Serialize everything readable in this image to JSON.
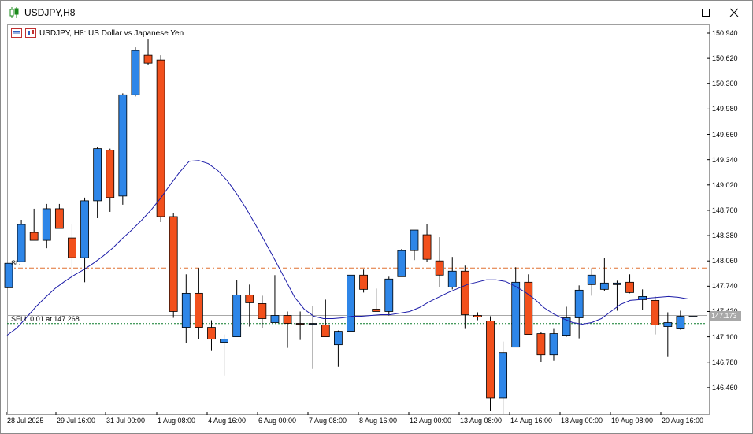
{
  "window": {
    "title": "USDJPY,H8"
  },
  "chart_header": {
    "text": "USDJPY, H8:  US Dollar vs Japanese Yen"
  },
  "trade_line": {
    "label": "SELL 0.01 at 147.268"
  },
  "current_price_tag": "147.173",
  "left_marker": "SU",
  "colors": {
    "bull": "#2e86e8",
    "bear": "#f2501c",
    "ma": "#1c1ca8",
    "sell_line": "#0a7a2a",
    "level_line": "#e07030",
    "price_line": "#a8a8a8"
  },
  "chart_data": {
    "type": "candlestick",
    "symbol": "USDJPY",
    "timeframe": "H8",
    "ylim": [
      146.16,
      150.96
    ],
    "y_ticks": [
      "150.940",
      "150.620",
      "150.300",
      "149.980",
      "149.660",
      "149.340",
      "149.020",
      "148.700",
      "148.380",
      "148.060",
      "147.740",
      "147.420",
      "147.100",
      "146.780",
      "146.460"
    ],
    "x_ticks": [
      "28 Jul 2025",
      "29 Jul 16:00",
      "31 Jul 00:00",
      "1 Aug 08:00",
      "4 Aug 16:00",
      "6 Aug 00:00",
      "7 Aug 08:00",
      "8 Aug 16:00",
      "12 Aug 00:00",
      "13 Aug 08:00",
      "14 Aug 16:00",
      "18 Aug 00:00",
      "19 Aug 08:00",
      "20 Aug 16:00"
    ],
    "sell_price": 147.268,
    "horizontal_level": 147.97,
    "current_price": 147.37,
    "candles": [
      {
        "o": 147.72,
        "h": 148.03,
        "l": 147.72,
        "c": 148.03
      },
      {
        "o": 148.05,
        "h": 148.58,
        "l": 148.05,
        "c": 148.52
      },
      {
        "o": 148.42,
        "h": 148.72,
        "l": 148.32,
        "c": 148.32
      },
      {
        "o": 148.32,
        "h": 148.78,
        "l": 148.22,
        "c": 148.72
      },
      {
        "o": 148.72,
        "h": 148.78,
        "l": 148.47,
        "c": 148.47
      },
      {
        "o": 148.35,
        "h": 148.52,
        "l": 147.82,
        "c": 148.1
      },
      {
        "o": 148.1,
        "h": 148.86,
        "l": 147.79,
        "c": 148.82
      },
      {
        "o": 148.82,
        "h": 149.5,
        "l": 148.6,
        "c": 149.48
      },
      {
        "o": 149.46,
        "h": 149.48,
        "l": 148.68,
        "c": 148.86
      },
      {
        "o": 148.88,
        "h": 150.18,
        "l": 148.77,
        "c": 150.16
      },
      {
        "o": 150.16,
        "h": 150.76,
        "l": 150.14,
        "c": 150.72
      },
      {
        "o": 150.66,
        "h": 150.86,
        "l": 150.54,
        "c": 150.56
      },
      {
        "o": 150.6,
        "h": 150.66,
        "l": 148.55,
        "c": 148.62
      },
      {
        "o": 148.62,
        "h": 148.67,
        "l": 147.34,
        "c": 147.42
      },
      {
        "o": 147.22,
        "h": 147.89,
        "l": 147.02,
        "c": 147.65
      },
      {
        "o": 147.65,
        "h": 147.97,
        "l": 147.07,
        "c": 147.22
      },
      {
        "o": 147.22,
        "h": 147.31,
        "l": 146.93,
        "c": 147.07
      },
      {
        "o": 147.03,
        "h": 147.13,
        "l": 146.61,
        "c": 147.07
      },
      {
        "o": 147.1,
        "h": 147.82,
        "l": 147.1,
        "c": 147.63
      },
      {
        "o": 147.63,
        "h": 147.76,
        "l": 147.23,
        "c": 147.53
      },
      {
        "o": 147.52,
        "h": 147.62,
        "l": 147.21,
        "c": 147.33
      },
      {
        "o": 147.28,
        "h": 147.88,
        "l": 147.28,
        "c": 147.37
      },
      {
        "o": 147.37,
        "h": 147.42,
        "l": 146.96,
        "c": 147.27
      },
      {
        "o": 147.27,
        "h": 147.42,
        "l": 147.06,
        "c": 147.26
      },
      {
        "o": 147.26,
        "h": 147.49,
        "l": 146.7,
        "c": 147.27
      },
      {
        "o": 147.25,
        "h": 147.57,
        "l": 147.1,
        "c": 147.1
      },
      {
        "o": 147.0,
        "h": 147.18,
        "l": 146.72,
        "c": 147.17
      },
      {
        "o": 147.17,
        "h": 147.91,
        "l": 147.15,
        "c": 147.88
      },
      {
        "o": 147.88,
        "h": 147.95,
        "l": 147.66,
        "c": 147.7
      },
      {
        "o": 147.45,
        "h": 147.71,
        "l": 147.43,
        "c": 147.42
      },
      {
        "o": 147.42,
        "h": 147.86,
        "l": 147.37,
        "c": 147.83
      },
      {
        "o": 147.86,
        "h": 148.21,
        "l": 147.86,
        "c": 148.19
      },
      {
        "o": 148.19,
        "h": 148.45,
        "l": 148.07,
        "c": 148.45
      },
      {
        "o": 148.39,
        "h": 148.53,
        "l": 148.05,
        "c": 148.08
      },
      {
        "o": 148.06,
        "h": 148.36,
        "l": 147.73,
        "c": 147.88
      },
      {
        "o": 147.73,
        "h": 148.11,
        "l": 147.7,
        "c": 147.93
      },
      {
        "o": 147.93,
        "h": 148.0,
        "l": 147.2,
        "c": 147.38
      },
      {
        "o": 147.37,
        "h": 147.41,
        "l": 147.31,
        "c": 147.35
      },
      {
        "o": 147.3,
        "h": 147.36,
        "l": 146.16,
        "c": 146.33
      },
      {
        "o": 146.33,
        "h": 147.04,
        "l": 146.13,
        "c": 146.9
      },
      {
        "o": 146.97,
        "h": 147.98,
        "l": 146.97,
        "c": 147.79
      },
      {
        "o": 147.79,
        "h": 147.89,
        "l": 147.13,
        "c": 147.13
      },
      {
        "o": 147.14,
        "h": 147.16,
        "l": 146.78,
        "c": 146.87
      },
      {
        "o": 146.87,
        "h": 147.2,
        "l": 146.8,
        "c": 147.14
      },
      {
        "o": 147.12,
        "h": 147.48,
        "l": 147.1,
        "c": 147.34
      },
      {
        "o": 147.34,
        "h": 147.75,
        "l": 147.08,
        "c": 147.69
      },
      {
        "o": 147.76,
        "h": 147.97,
        "l": 147.62,
        "c": 147.88
      },
      {
        "o": 147.7,
        "h": 148.1,
        "l": 147.68,
        "c": 147.78
      },
      {
        "o": 147.76,
        "h": 147.81,
        "l": 147.43,
        "c": 147.78
      },
      {
        "o": 147.79,
        "h": 147.89,
        "l": 147.65,
        "c": 147.66
      },
      {
        "o": 147.57,
        "h": 147.7,
        "l": 147.44,
        "c": 147.61
      },
      {
        "o": 147.56,
        "h": 147.61,
        "l": 147.13,
        "c": 147.25
      },
      {
        "o": 147.23,
        "h": 147.41,
        "l": 146.85,
        "c": 147.28
      },
      {
        "o": 147.2,
        "h": 147.43,
        "l": 147.19,
        "c": 147.36
      },
      {
        "o": 147.36,
        "h": 147.36,
        "l": 147.36,
        "c": 147.36
      }
    ],
    "ma": [
      147.12,
      147.21,
      147.34,
      147.48,
      147.6,
      147.71,
      147.8,
      147.88,
      147.95,
      148.03,
      148.12,
      148.22,
      148.34,
      148.45,
      148.57,
      148.7,
      148.85,
      149.02,
      149.18,
      149.32,
      149.33,
      149.29,
      149.2,
      149.07,
      148.9,
      148.71,
      148.5,
      148.28,
      148.06,
      147.83,
      147.6,
      147.45,
      147.36,
      147.33,
      147.33,
      147.34,
      147.36,
      147.36,
      147.37,
      147.38,
      147.38,
      147.4,
      147.42,
      147.47,
      147.54,
      147.6,
      147.66,
      147.71,
      147.76,
      147.79,
      147.82,
      147.82,
      147.8,
      147.74,
      147.67,
      147.58,
      147.47,
      147.39,
      147.33,
      147.28,
      147.26,
      147.28,
      147.33,
      147.42,
      147.51,
      147.56,
      147.57,
      147.59,
      147.6,
      147.61,
      147.6,
      147.58
    ]
  }
}
